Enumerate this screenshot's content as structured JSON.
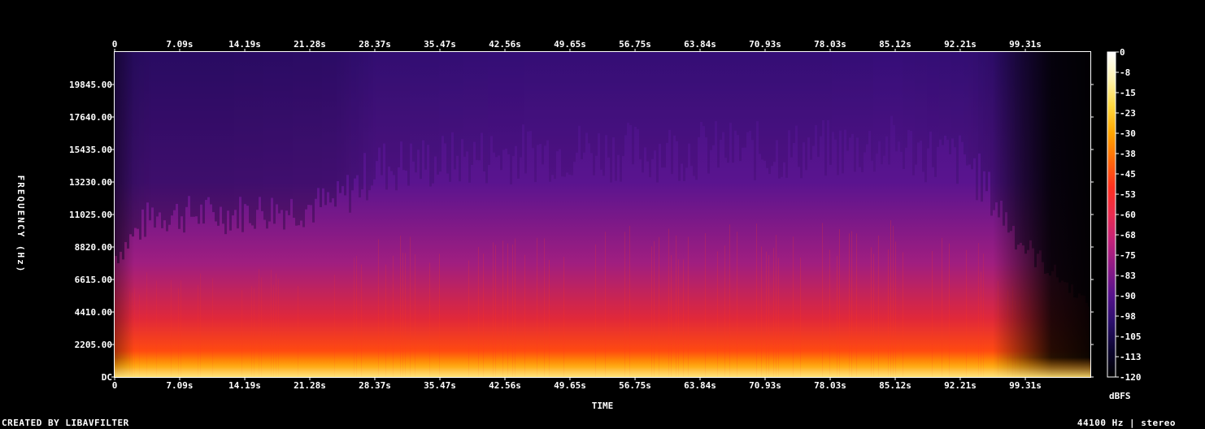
{
  "chart_data": {
    "type": "heatmap",
    "title": "",
    "xlabel": "TIME",
    "ylabel": "FREQUENCY (Hz)",
    "x_ticks": [
      "0",
      "7.09s",
      "14.19s",
      "21.28s",
      "28.37s",
      "35.47s",
      "42.56s",
      "49.65s",
      "56.75s",
      "63.84s",
      "70.93s",
      "78.03s",
      "85.12s",
      "92.21s",
      "99.31s"
    ],
    "x_tick_values": [
      0,
      7.09,
      14.19,
      21.28,
      28.37,
      35.47,
      42.56,
      49.65,
      56.75,
      63.84,
      70.93,
      78.03,
      85.12,
      92.21,
      99.31
    ],
    "xlim": [
      0,
      106.4
    ],
    "y_ticks": [
      "DC",
      "2205.00",
      "4410.00",
      "6615.00",
      "8820.00",
      "11025.00",
      "13230.00",
      "15435.00",
      "17640.00",
      "19845.00"
    ],
    "y_tick_values": [
      0,
      2205,
      4410,
      6615,
      8820,
      11025,
      13230,
      15435,
      17640,
      19845
    ],
    "ylim": [
      0,
      22050
    ],
    "colorbar": {
      "label": "dBFS",
      "ticks": [
        "0",
        "-8",
        "-15",
        "-23",
        "-30",
        "-38",
        "-45",
        "-53",
        "-60",
        "-68",
        "-75",
        "-83",
        "-90",
        "-98",
        "-105",
        "-113",
        "-120"
      ],
      "range": [
        -120,
        0
      ],
      "colors": [
        "#000000",
        "#0c0530",
        "#2a0f6b",
        "#55128c",
        "#8a1a86",
        "#c0227a",
        "#e82c50",
        "#ff3020",
        "#ff6a0a",
        "#ffa500",
        "#ffd840",
        "#fff3b0",
        "#ffffff"
      ]
    },
    "profile": {
      "description_free": true,
      "time_activity": [
        0.35,
        0.55,
        0.55,
        0.6,
        0.78,
        0.8,
        0.84,
        0.86,
        0.85,
        0.86,
        0.85,
        0.86,
        0.88,
        0.8,
        0.4,
        0.12
      ],
      "time_activity_x": [
        0,
        4,
        12,
        24,
        28.4,
        34,
        42,
        50,
        57,
        64,
        71,
        78,
        85,
        93,
        99,
        106
      ]
    }
  },
  "footer": {
    "left": "CREATED BY LIBAVFILTER",
    "right": "44100 Hz | stereo"
  }
}
